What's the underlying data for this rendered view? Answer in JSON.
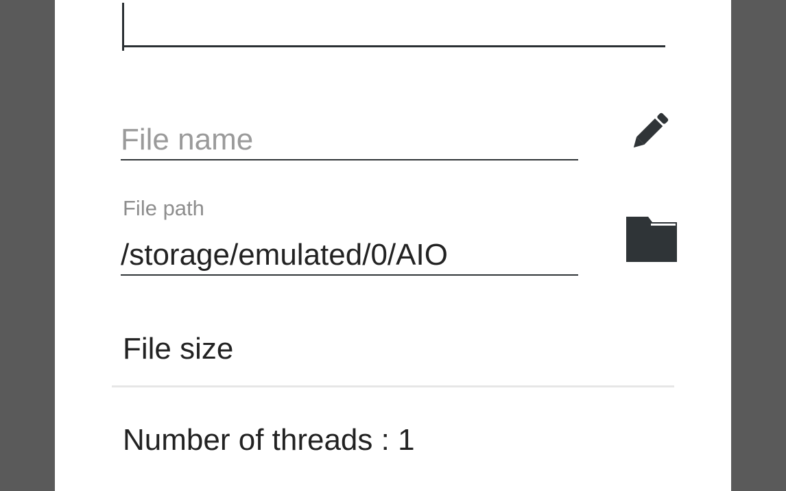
{
  "dialog": {
    "url_field": {
      "value": ""
    },
    "file_name": {
      "value": "",
      "placeholder": "File name"
    },
    "file_path": {
      "label": "File path",
      "value": "/storage/emulated/0/AIO"
    },
    "file_size_label": "File size",
    "threads_label": "Number of threads : 1",
    "icons": {
      "edit": "pencil-icon",
      "browse": "folder-icon"
    },
    "colors": {
      "icon": "#2f3437",
      "scrim": "#5a5a5a",
      "surface": "#ffffff"
    }
  }
}
